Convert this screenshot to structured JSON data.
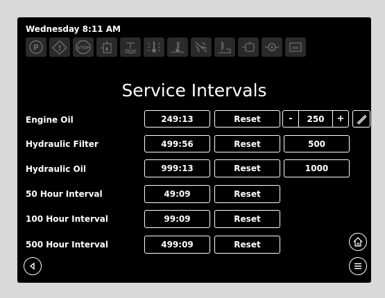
{
  "status": {
    "datetime": "Wednesday 8:11 AM"
  },
  "warning_icons": [
    "parking-brake-icon",
    "warning-triangle-icon",
    "stop-icon",
    "fuel-water-icon",
    "coolant-level-icon",
    "hydraulic-temp-icon",
    "coolant-temp-icon",
    "air-filter-icon",
    "hydraulic-level-icon",
    "oil-pressure-icon",
    "engine-oil-icon",
    "battery-icon"
  ],
  "page": {
    "title": "Service Intervals"
  },
  "rows": [
    {
      "label": "Engine Oil",
      "value": "249:13",
      "reset": "Reset"
    },
    {
      "label": "Hydraulic Filter",
      "value": "499:56",
      "reset": "Reset",
      "interval": "500"
    },
    {
      "label": "Hydraulic Oil",
      "value": "999:13",
      "reset": "Reset",
      "interval": "1000"
    },
    {
      "label": "50 Hour Interval",
      "value": "49:09",
      "reset": "Reset"
    },
    {
      "label": "100 Hour Interval",
      "value": "99:09",
      "reset": "Reset"
    },
    {
      "label": "500 Hour Interval",
      "value": "499:09",
      "reset": "Reset"
    }
  ],
  "stepper": {
    "minus": "-",
    "value": "250",
    "plus": "+"
  },
  "colors": {
    "background": "#000000",
    "foreground": "#ffffff",
    "icon_inactive": "#6a6a6a"
  }
}
